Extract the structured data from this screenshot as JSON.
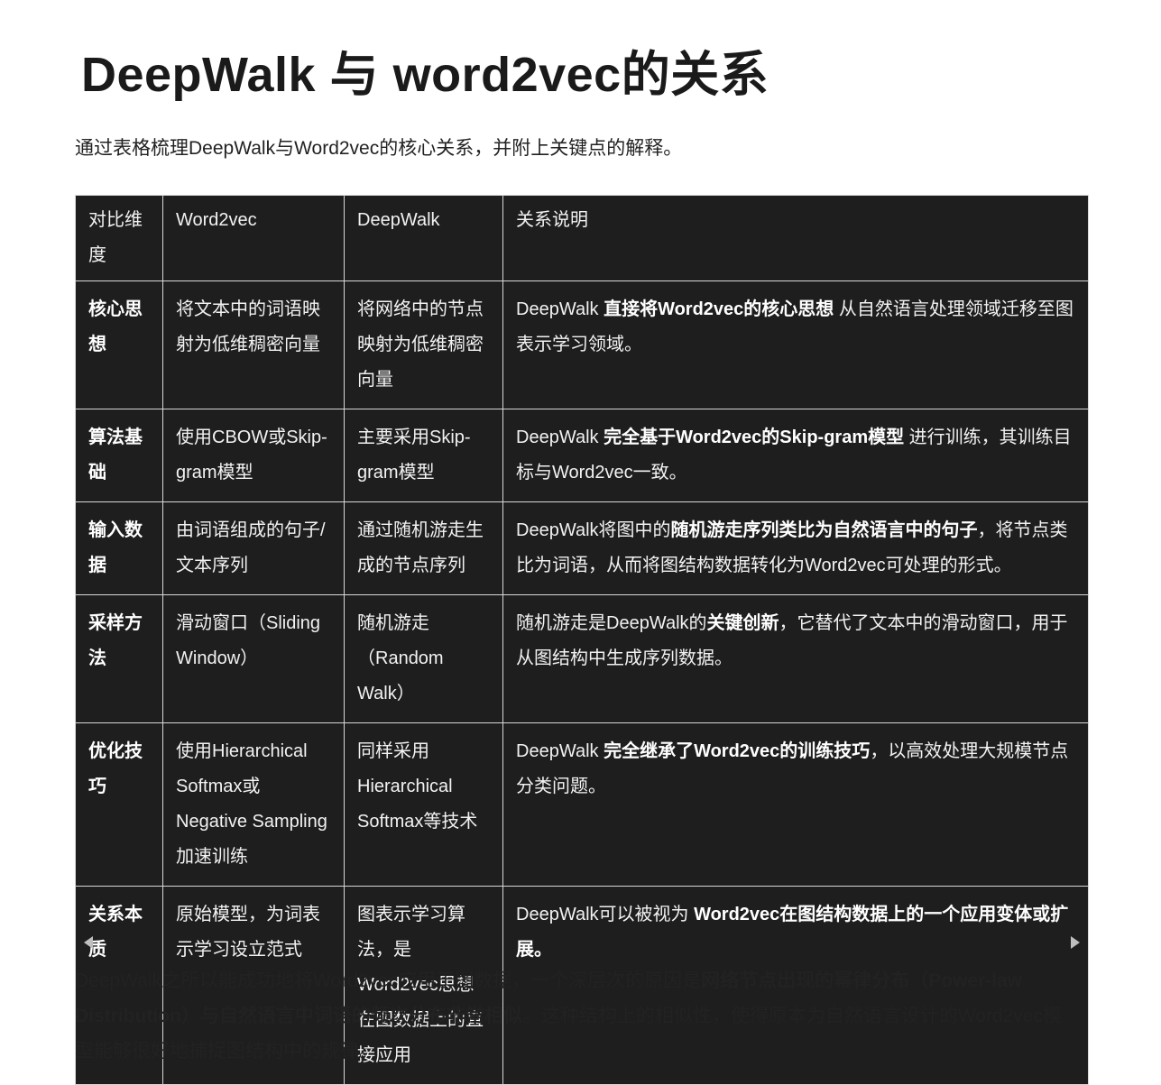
{
  "title": "DeepWalk 与 word2vec的关系",
  "intro": "通过表格梳理DeepWalk与Word2vec的核心关系，并附上关键点的解释。",
  "table": {
    "headers": [
      "对比维度",
      "Word2vec",
      "DeepWalk",
      "关系说明"
    ],
    "rows": [
      {
        "dim": "核心思想",
        "w2v": "将文本中的词语映射为低维稠密向量",
        "dw": "将网络中的节点映射为低维稠密向量",
        "rel": [
          {
            "t": "DeepWalk ",
            "b": false
          },
          {
            "t": "直接将Word2vec的核心思想",
            "b": true
          },
          {
            "t": " 从自然语言处理领域迁移至图表示学习领域。",
            "b": false
          }
        ]
      },
      {
        "dim": "算法基础",
        "w2v": "使用CBOW或Skip-gram模型",
        "dw": "主要采用Skip-gram模型",
        "rel": [
          {
            "t": "DeepWalk ",
            "b": false
          },
          {
            "t": "完全基于Word2vec的Skip-gram模型",
            "b": true
          },
          {
            "t": " 进行训练，其训练目标与Word2vec一致。",
            "b": false
          }
        ]
      },
      {
        "dim": "输入数据",
        "w2v": "由词语组成的句子/文本序列",
        "dw": "通过随机游走生成的节点序列",
        "rel": [
          {
            "t": "DeepWalk将图中的",
            "b": false
          },
          {
            "t": "随机游走序列类比为自然语言中的句子",
            "b": true
          },
          {
            "t": "，将节点类比为词语，从而将图结构数据转化为Word2vec可处理的形式。",
            "b": false
          }
        ]
      },
      {
        "dim": "采样方法",
        "w2v": "滑动窗口（Sliding Window）",
        "dw": "随机游走（Random Walk）",
        "rel": [
          {
            "t": "随机游走是DeepWalk的",
            "b": false
          },
          {
            "t": "关键创新",
            "b": true
          },
          {
            "t": "，它替代了文本中的滑动窗口，用于从图结构中生成序列数据。",
            "b": false
          }
        ]
      },
      {
        "dim": "优化技巧",
        "w2v": "使用Hierarchical Softmax或Negative Sampling加速训练",
        "dw": "同样采用Hierarchical Softmax等技术",
        "rel": [
          {
            "t": "DeepWalk ",
            "b": false
          },
          {
            "t": "完全继承了Word2vec的训练技巧",
            "b": true
          },
          {
            "t": "，以高效处理大规模节点分类问题。",
            "b": false
          }
        ]
      },
      {
        "dim": "关系本质",
        "w2v": "原始模型，为词表示学习设立范式",
        "dw": "图表示学习算法，是Word2vec思想在图数据上的直接应用",
        "rel": [
          {
            "t": "DeepWalk可以被视为 ",
            "b": false
          },
          {
            "t": "Word2vec在图结构数据上的一个应用变体或扩展。",
            "b": true
          }
        ]
      }
    ]
  },
  "outro": [
    {
      "t": "DeepWalk之所以能成功地将Word2vec应用于图数据，一个深层次的原因是",
      "b": false
    },
    {
      "t": "网络节点出现的幂律分布（Power-law Distribution）与自然语言中词语的频次分布非常相似",
      "b": true
    },
    {
      "t": "。这种结构上的相似性，使得原本为自然语言设计的Word2vec模型能够很好地捕捉图结构中的规律。",
      "b": false
    }
  ]
}
